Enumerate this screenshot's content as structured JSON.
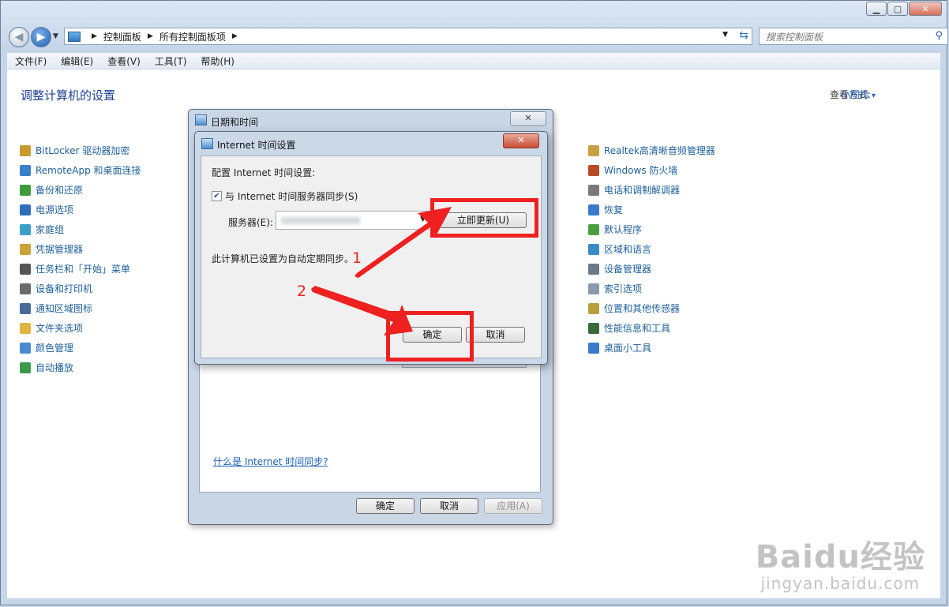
{
  "address_bar": {
    "crumbs": [
      "控制面板",
      "所有控制面板项"
    ],
    "search_placeholder": "搜索控制面板"
  },
  "menu": [
    "文件(F)",
    "编辑(E)",
    "查看(V)",
    "工具(T)",
    "帮助(H)"
  ],
  "page": {
    "title": "调整计算机的设置",
    "view_by_label": "查看方式:",
    "view_by_value": "小图标"
  },
  "left_items": [
    {
      "label": "BitLocker 驱动器加密",
      "icon": "bitlocker-icon",
      "color": "#c99a2e"
    },
    {
      "label": "RemoteApp 和桌面连接",
      "icon": "remoteapp-icon",
      "color": "#3a7fc8"
    },
    {
      "label": "备份和还原",
      "icon": "backup-icon",
      "color": "#3e9a3a"
    },
    {
      "label": "电源选项",
      "icon": "power-icon",
      "color": "#2d6fb8"
    },
    {
      "label": "家庭组",
      "icon": "homegroup-icon",
      "color": "#3aa0c8"
    },
    {
      "label": "凭据管理器",
      "icon": "credential-icon",
      "color": "#c9a23a"
    },
    {
      "label": "任务栏和「开始」菜单",
      "icon": "taskbar-icon",
      "color": "#555555"
    },
    {
      "label": "设备和打印机",
      "icon": "printer-icon",
      "color": "#6a6a6a"
    },
    {
      "label": "通知区域图标",
      "icon": "notification-icon",
      "color": "#4a6a9a"
    },
    {
      "label": "文件夹选项",
      "icon": "folder-icon",
      "color": "#e0b440"
    },
    {
      "label": "颜色管理",
      "icon": "color-icon",
      "color": "#4a8ad0"
    },
    {
      "label": "自动播放",
      "icon": "autoplay-icon",
      "color": "#3a9a4a"
    }
  ],
  "right_items": [
    {
      "label": "Realtek高清晰音频管理器",
      "icon": "audio-icon",
      "color": "#c8a040"
    },
    {
      "label": "Windows 防火墙",
      "icon": "firewall-icon",
      "color": "#b84a2a"
    },
    {
      "label": "电话和调制解调器",
      "icon": "phone-icon",
      "color": "#7a7a7a"
    },
    {
      "label": "恢复",
      "icon": "recovery-icon",
      "color": "#3a7ac8"
    },
    {
      "label": "默认程序",
      "icon": "default-programs-icon",
      "color": "#4aa040"
    },
    {
      "label": "区域和语言",
      "icon": "region-icon",
      "color": "#3a8ac8"
    },
    {
      "label": "设备管理器",
      "icon": "device-manager-icon",
      "color": "#6a7a8a"
    },
    {
      "label": "索引选项",
      "icon": "indexing-icon",
      "color": "#8a9aaa"
    },
    {
      "label": "位置和其他传感器",
      "icon": "sensor-icon",
      "color": "#b8a040"
    },
    {
      "label": "性能信息和工具",
      "icon": "performance-icon",
      "color": "#3a6a3a"
    },
    {
      "label": "桌面小工具",
      "icon": "gadgets-icon",
      "color": "#3a7ac8"
    }
  ],
  "outer_dialog": {
    "title": "日期和时间",
    "link": "什么是 Internet 时间同步?",
    "ok": "确定",
    "cancel": "取消",
    "apply": "应用(A)"
  },
  "inner_dialog": {
    "title": "Internet 时间设置",
    "heading": "配置 Internet 时间设置:",
    "sync_label": "与 Internet 时间服务器同步(S)",
    "sync_checked": true,
    "server_label": "服务器(E):",
    "update_now": "立即更新(U)",
    "status": "此计算机已设置为自动定期同步。",
    "ok": "确定",
    "cancel": "取消"
  },
  "annotations": [
    "1",
    "2"
  ],
  "annotation_color": "#ef2020",
  "watermark": {
    "main": "Baidu经验",
    "sub": "jingyan.baidu.com"
  }
}
